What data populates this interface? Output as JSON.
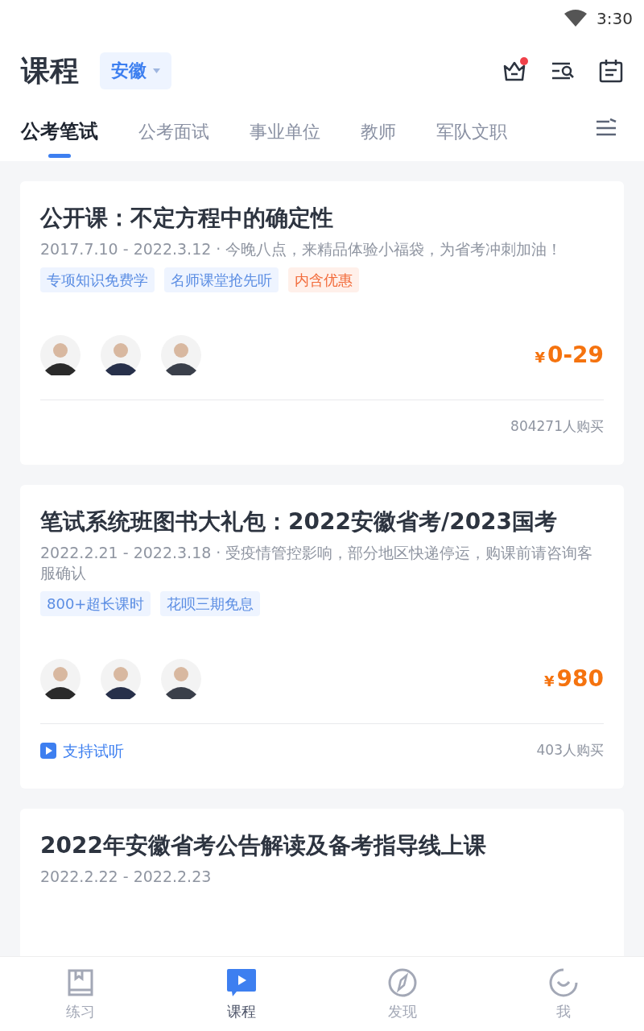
{
  "status_bar": {
    "time": "3:30"
  },
  "header": {
    "title": "课程",
    "region": "安徽",
    "notification_dot": true
  },
  "tabs": [
    {
      "label": "公考笔试",
      "selected": true
    },
    {
      "label": "公考面试",
      "selected": false
    },
    {
      "label": "事业单位",
      "selected": false
    },
    {
      "label": "教师",
      "selected": false
    },
    {
      "label": "军队文职",
      "selected": false
    }
  ],
  "courses": [
    {
      "title": "公开课：不定方程中的确定性",
      "subtitle": "2017.7.10 - 2022.3.12 · 今晚八点，来精品体验小福袋，为省考冲刺加油！",
      "tags": [
        {
          "label": "专项知识免费学",
          "kind": "feature"
        },
        {
          "label": "名师课堂抢先听",
          "kind": "feature"
        },
        {
          "label": "内含优惠",
          "kind": "promo"
        }
      ],
      "currency": "¥",
      "price": "0-29",
      "buyers": "804271人购买"
    },
    {
      "title": "笔试系统班图书大礼包：2022安徽省考/2023国考",
      "subtitle": "2022.2.21 - 2022.3.18 · 受疫情管控影响，部分地区快递停运，购课前请咨询客服确认",
      "tags": [
        {
          "label": "800+超长课时",
          "kind": "feature"
        },
        {
          "label": "花呗三期免息",
          "kind": "feature"
        }
      ],
      "currency": "¥",
      "price": "980",
      "trial": "支持试听",
      "buyers": "403人购买"
    },
    {
      "title": "2022年安徽省考公告解读及备考指导线上课",
      "subtitle": "2022.2.22 - 2022.2.23"
    }
  ],
  "bottom_nav": [
    {
      "label": "练习",
      "selected": false
    },
    {
      "label": "课程",
      "selected": true
    },
    {
      "label": "发现",
      "selected": false
    },
    {
      "label": "我",
      "selected": false
    }
  ]
}
